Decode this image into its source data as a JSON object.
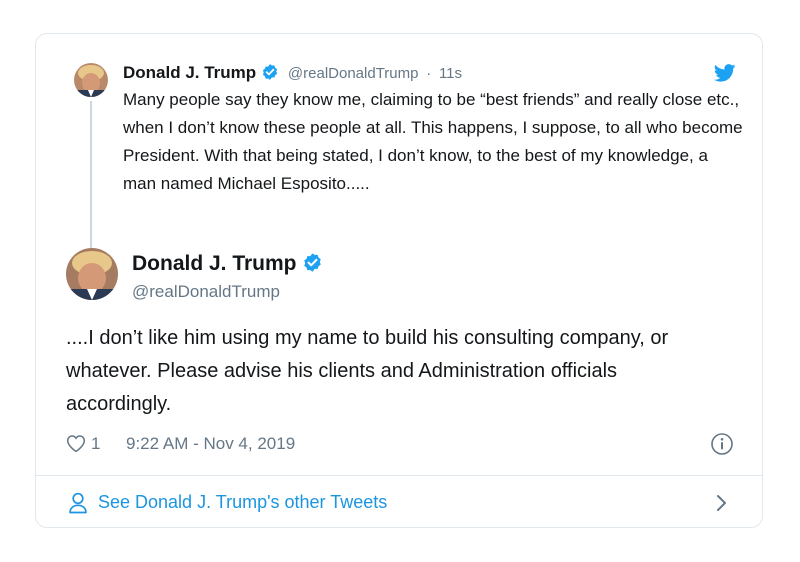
{
  "parent_tweet": {
    "name": "Donald J. Trump",
    "handle": "@realDonaldTrump",
    "separator": "·",
    "time_ago": "11s",
    "text": "Many people say they know me, claiming to be “best friends” and really close etc., when I don’t know these people at all. This happens, I suppose, to all who become President. With that being stated, I don’t know, to the best of my knowledge, a man named Michael Esposito....."
  },
  "main_tweet": {
    "name": "Donald J. Trump",
    "handle": "@realDonaldTrump",
    "text": "....I don’t like him using my name to build his consulting company, or whatever. Please advise his clients and Administration officials accordingly.",
    "like_count": "1",
    "timestamp": "9:22 AM - Nov 4, 2019"
  },
  "footer": {
    "label": "See Donald J. Trump's other Tweets"
  },
  "colors": {
    "accent": "#1b95e0",
    "verified": "#1da1f2",
    "muted": "#657786",
    "border": "#e1e8ed"
  },
  "icons": [
    "twitter-bird-icon",
    "verified-icon",
    "heart-icon",
    "info-icon",
    "person-icon",
    "chevron-right-icon"
  ]
}
